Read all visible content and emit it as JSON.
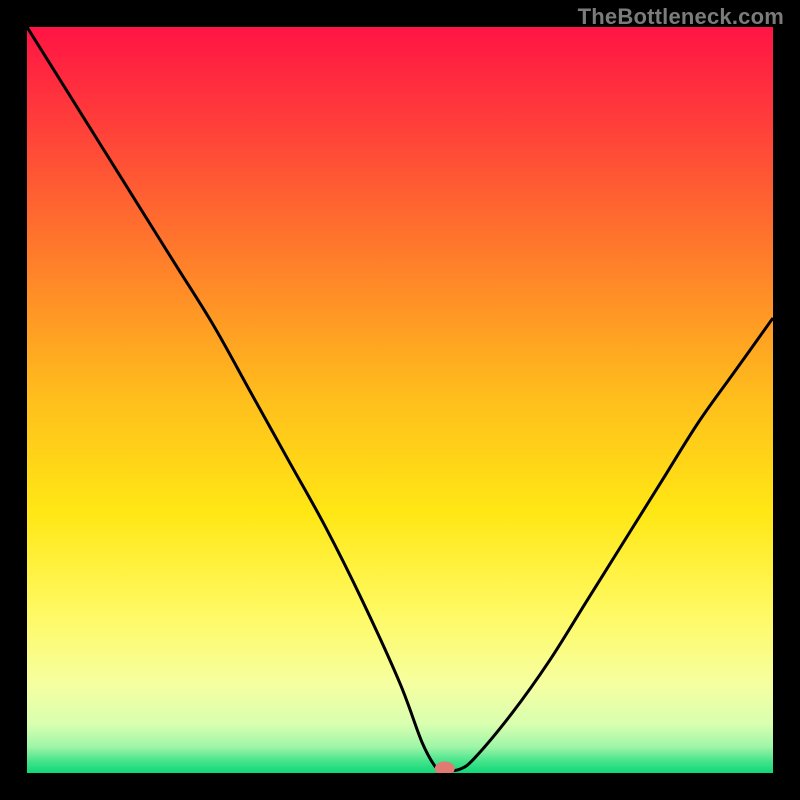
{
  "watermark": "TheBottleneck.com",
  "colors": {
    "frame": "#000000",
    "watermark": "#7b7b7b",
    "marker_fill": "#e17a72",
    "curve": "#000000",
    "gradient_stops": [
      {
        "offset": 0.0,
        "color": "#ff1444"
      },
      {
        "offset": 0.12,
        "color": "#ff3b3b"
      },
      {
        "offset": 0.3,
        "color": "#ff7a2b"
      },
      {
        "offset": 0.5,
        "color": "#ffbf1c"
      },
      {
        "offset": 0.65,
        "color": "#ffe714"
      },
      {
        "offset": 0.78,
        "color": "#fff960"
      },
      {
        "offset": 0.88,
        "color": "#f6ffa0"
      },
      {
        "offset": 0.935,
        "color": "#d8ffb0"
      },
      {
        "offset": 0.965,
        "color": "#9ef5a8"
      },
      {
        "offset": 0.985,
        "color": "#42e38a"
      },
      {
        "offset": 1.0,
        "color": "#10d878"
      }
    ]
  },
  "chart_data": {
    "type": "line",
    "title": "",
    "xlabel": "",
    "ylabel": "",
    "xlim": [
      0,
      100
    ],
    "ylim": [
      0,
      100
    ],
    "grid": false,
    "series": [
      {
        "name": "bottleneck-curve",
        "x": [
          0,
          5,
          10,
          15,
          20,
          25,
          30,
          35,
          40,
          45,
          50,
          53,
          55,
          56,
          58,
          60,
          65,
          70,
          75,
          80,
          85,
          90,
          95,
          100
        ],
        "values": [
          100,
          92,
          84,
          76,
          68,
          60,
          51,
          42,
          33,
          23,
          12,
          4,
          0.5,
          0.3,
          0.5,
          2,
          8,
          15,
          23,
          31,
          39,
          47,
          54,
          61
        ]
      }
    ],
    "marker": {
      "x": 56,
      "y": 0.6,
      "color": "#e17a72"
    }
  }
}
